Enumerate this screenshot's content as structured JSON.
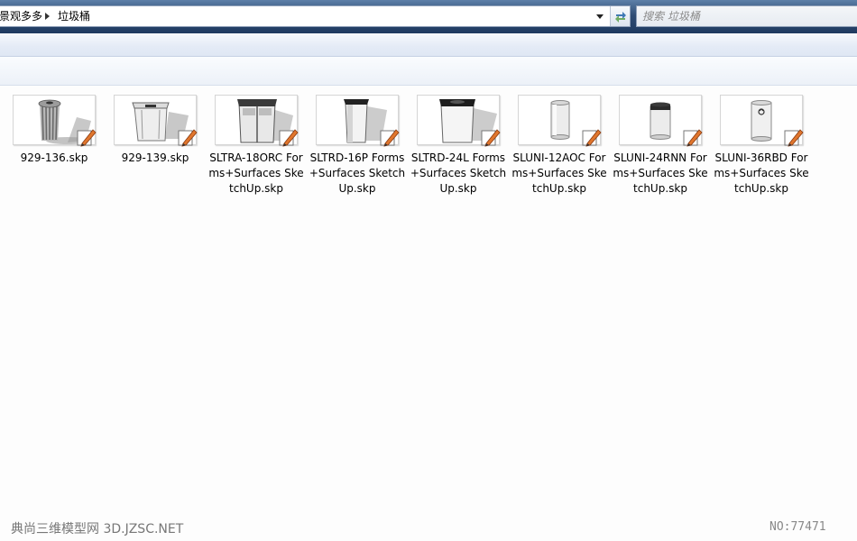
{
  "address_bar": {
    "crumbs": [
      "景观多多",
      "垃圾桶"
    ]
  },
  "search": {
    "placeholder": "搜索 垃圾桶"
  },
  "files": [
    {
      "name": "929-136.skp",
      "thumb_icon": "trash-can-ribbed-icon"
    },
    {
      "name": "929-139.skp",
      "thumb_icon": "trash-can-box-icon"
    },
    {
      "name": "SLTRA-18ORC Forms+Surfaces SketchUp.skp",
      "thumb_icon": "trash-can-double-icon"
    },
    {
      "name": "SLTRD-16P Forms+Surfaces SketchUp.skp",
      "thumb_icon": "trash-can-square-dark-lid-icon"
    },
    {
      "name": "SLTRD-24L Forms+Surfaces SketchUp.skp",
      "thumb_icon": "trash-can-wide-dark-lid-icon"
    },
    {
      "name": "SLUNI-12AOC Forms+Surfaces SketchUp.skp",
      "thumb_icon": "trash-can-cylinder-icon"
    },
    {
      "name": "SLUNI-24RNN Forms+Surfaces SketchUp.skp",
      "thumb_icon": "trash-can-cylinder-dark-top-icon"
    },
    {
      "name": "SLUNI-36RBD Forms+Surfaces SketchUp.skp",
      "thumb_icon": "trash-can-recycle-icon"
    }
  ],
  "watermark": {
    "left": "典尚三维模型网 3D.JZSC.NET",
    "right": "NO:77471"
  },
  "colors": {
    "titlebar": "#2f4d75",
    "badge_pencil": "#d44a1a"
  }
}
